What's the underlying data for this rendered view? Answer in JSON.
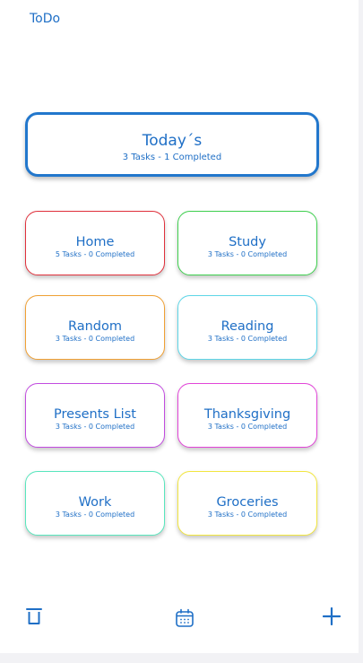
{
  "app": {
    "title": "ToDo"
  },
  "today": {
    "title": "Today´s",
    "subtitle": "3 Tasks - 1 Completed",
    "color": "#2277cc"
  },
  "lists": [
    {
      "title": "Home",
      "subtitle": "5 Tasks - 0 Completed",
      "color": "#e0313c"
    },
    {
      "title": "Study",
      "subtitle": "3 Tasks - 0 Completed",
      "color": "#3fd04f"
    },
    {
      "title": "Random",
      "subtitle": "3 Tasks - 0 Completed",
      "color": "#f0a033"
    },
    {
      "title": "Reading",
      "subtitle": "3 Tasks - 0 Completed",
      "color": "#5ed6e8"
    },
    {
      "title": "Presents List",
      "subtitle": "3 Tasks - 0 Completed",
      "color": "#c24be0"
    },
    {
      "title": "Thanksgiving",
      "subtitle": "3 Tasks - 0 Completed",
      "color": "#e244d8"
    },
    {
      "title": "Work",
      "subtitle": "3 Tasks - 0 Completed",
      "color": "#58e6bd"
    },
    {
      "title": "Groceries",
      "subtitle": "3 Tasks - 0 Completed",
      "color": "#f2e63f"
    }
  ],
  "toolbar": {
    "icons": [
      "trash-icon",
      "calendar-icon",
      "plus-icon"
    ],
    "accent": "#1f6fc6"
  }
}
